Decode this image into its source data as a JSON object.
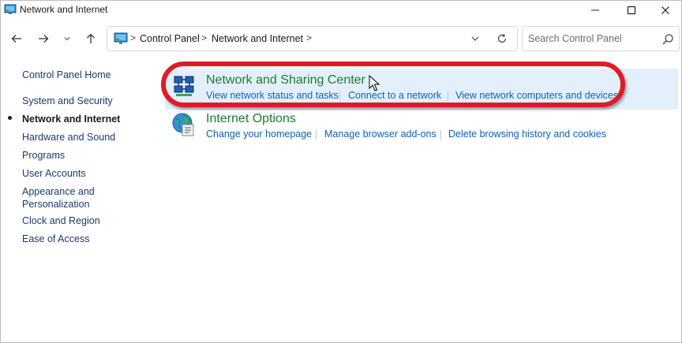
{
  "window": {
    "title": "Network and Internet"
  },
  "addressbar": {
    "breadcrumbs": [
      "Control Panel",
      "Network and Internet"
    ],
    "separator": ">"
  },
  "search": {
    "placeholder": "Search Control Panel"
  },
  "sidebar": {
    "home_label": "Control Panel Home",
    "items": [
      {
        "label": "System and Security"
      },
      {
        "label": "Network and Internet",
        "current": true
      },
      {
        "label": "Hardware and Sound"
      },
      {
        "label": "Programs"
      },
      {
        "label": "User Accounts"
      },
      {
        "label": "Appearance and",
        "label2": "Personalization"
      },
      {
        "label": "Clock and Region"
      },
      {
        "label": "Ease of Access"
      }
    ]
  },
  "categories": [
    {
      "title": "Network and Sharing Center",
      "tasks": [
        "View network status and tasks",
        "Connect to a network",
        "View network computers and devices"
      ]
    },
    {
      "title": "Internet Options",
      "tasks": [
        "Change your homepage",
        "Manage browser add-ons",
        "Delete browsing history and cookies"
      ]
    }
  ],
  "colors": {
    "accent_link": "#0b62b8",
    "category_title": "#1e7a2e",
    "highlight": "#e3f0fc",
    "annotation_ring": "#e01b24"
  },
  "icons": [
    "control-panel-icon",
    "back-arrow-icon",
    "forward-arrow-icon",
    "chevron-down-icon",
    "up-arrow-icon",
    "refresh-icon",
    "search-icon",
    "network-sharing-icon",
    "internet-options-icon",
    "mouse-cursor-icon"
  ]
}
